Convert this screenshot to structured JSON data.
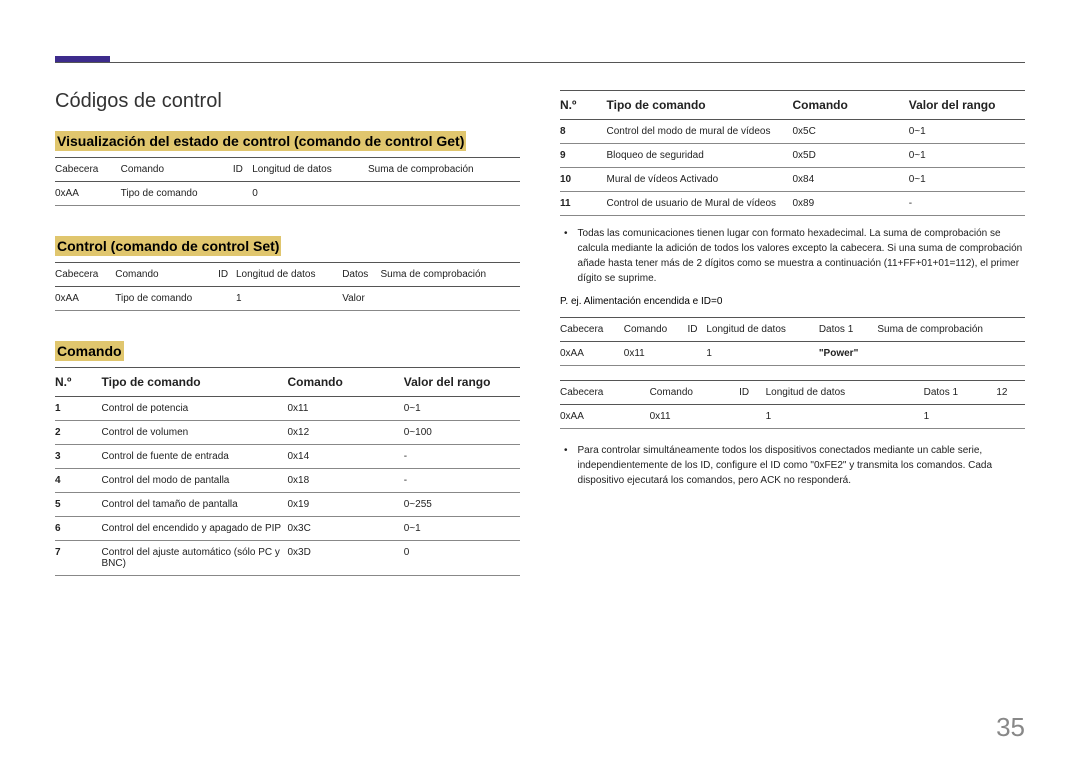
{
  "h1": "Códigos de control",
  "section1": "Visualización del estado de control (comando de control Get)",
  "t1_headers": [
    "Cabecera",
    "Comando",
    "ID",
    "Longitud de datos",
    "Suma de comprobación"
  ],
  "t1_row": [
    "0xAA",
    "Tipo de comando",
    "",
    "0",
    ""
  ],
  "section2": "Control (comando de control Set)",
  "t2_headers": [
    "Cabecera",
    "Comando",
    "ID",
    "Longitud de datos",
    "Datos",
    "Suma de comprobación"
  ],
  "t2_row": [
    "0xAA",
    "Tipo de comando",
    "",
    "1",
    "Valor",
    ""
  ],
  "section3": "Comando",
  "cmd_headers": {
    "no": "N.º",
    "tipo": "Tipo de comando",
    "cmd": "Comando",
    "rango": "Valor del rango"
  },
  "cmd_rows_left": [
    {
      "n": "1",
      "tipo": "Control de potencia",
      "cmd": "0x11",
      "rango": "0~1"
    },
    {
      "n": "2",
      "tipo": "Control de volumen",
      "cmd": "0x12",
      "rango": "0~100"
    },
    {
      "n": "3",
      "tipo": "Control de fuente de entrada",
      "cmd": "0x14",
      "rango": "-"
    },
    {
      "n": "4",
      "tipo": "Control del modo de pantalla",
      "cmd": "0x18",
      "rango": "-"
    },
    {
      "n": "5",
      "tipo": "Control del tamaño de pantalla",
      "cmd": "0x19",
      "rango": "0~255"
    },
    {
      "n": "6",
      "tipo": "Control del encendido y apagado de PIP",
      "cmd": "0x3C",
      "rango": "0~1"
    },
    {
      "n": "7",
      "tipo": "Control del ajuste automático (sólo PC y BNC)",
      "cmd": "0x3D",
      "rango": "0"
    }
  ],
  "cmd_rows_right": [
    {
      "n": "8",
      "tipo": "Control del modo de mural de vídeos",
      "cmd": "0x5C",
      "rango": "0~1"
    },
    {
      "n": "9",
      "tipo": "Bloqueo de seguridad",
      "cmd": "0x5D",
      "rango": "0~1"
    },
    {
      "n": "10",
      "tipo": "Mural de vídeos Activado",
      "cmd": "0x84",
      "rango": "0~1"
    },
    {
      "n": "11",
      "tipo": "Control de usuario de Mural de vídeos",
      "cmd": "0x89",
      "rango": "-"
    }
  ],
  "bullet1": "Todas las comunicaciones tienen lugar con formato hexadecimal. La suma de comprobación se calcula mediante la adición de todos los valores excepto la cabecera. Si una suma de comprobación añade hasta tener más de 2 dígitos como se muestra a continuación (11+FF+01+01=112), el primer dígito se suprime.",
  "example_line": "P. ej. Alimentación encendida e ID=0",
  "ex_headers": [
    "Cabecera",
    "Comando",
    "ID",
    "Longitud de datos",
    "Datos 1",
    "Suma de comprobación"
  ],
  "ex_row1": [
    "0xAA",
    "0x11",
    "",
    "1",
    "\"Power\"",
    ""
  ],
  "ex_headers2": [
    "Cabecera",
    "Comando",
    "ID",
    "Longitud de datos",
    "Datos 1",
    "12"
  ],
  "ex_row2": [
    "0xAA",
    "0x11",
    "",
    "1",
    "1",
    ""
  ],
  "bullet2": "Para controlar simultáneamente todos los dispositivos conectados mediante un cable serie, independientemente de los ID, configure el ID como \"0xFE2\" y transmita los comandos. Cada dispositivo ejecutará los comandos, pero ACK no responderá.",
  "page_number": "35"
}
